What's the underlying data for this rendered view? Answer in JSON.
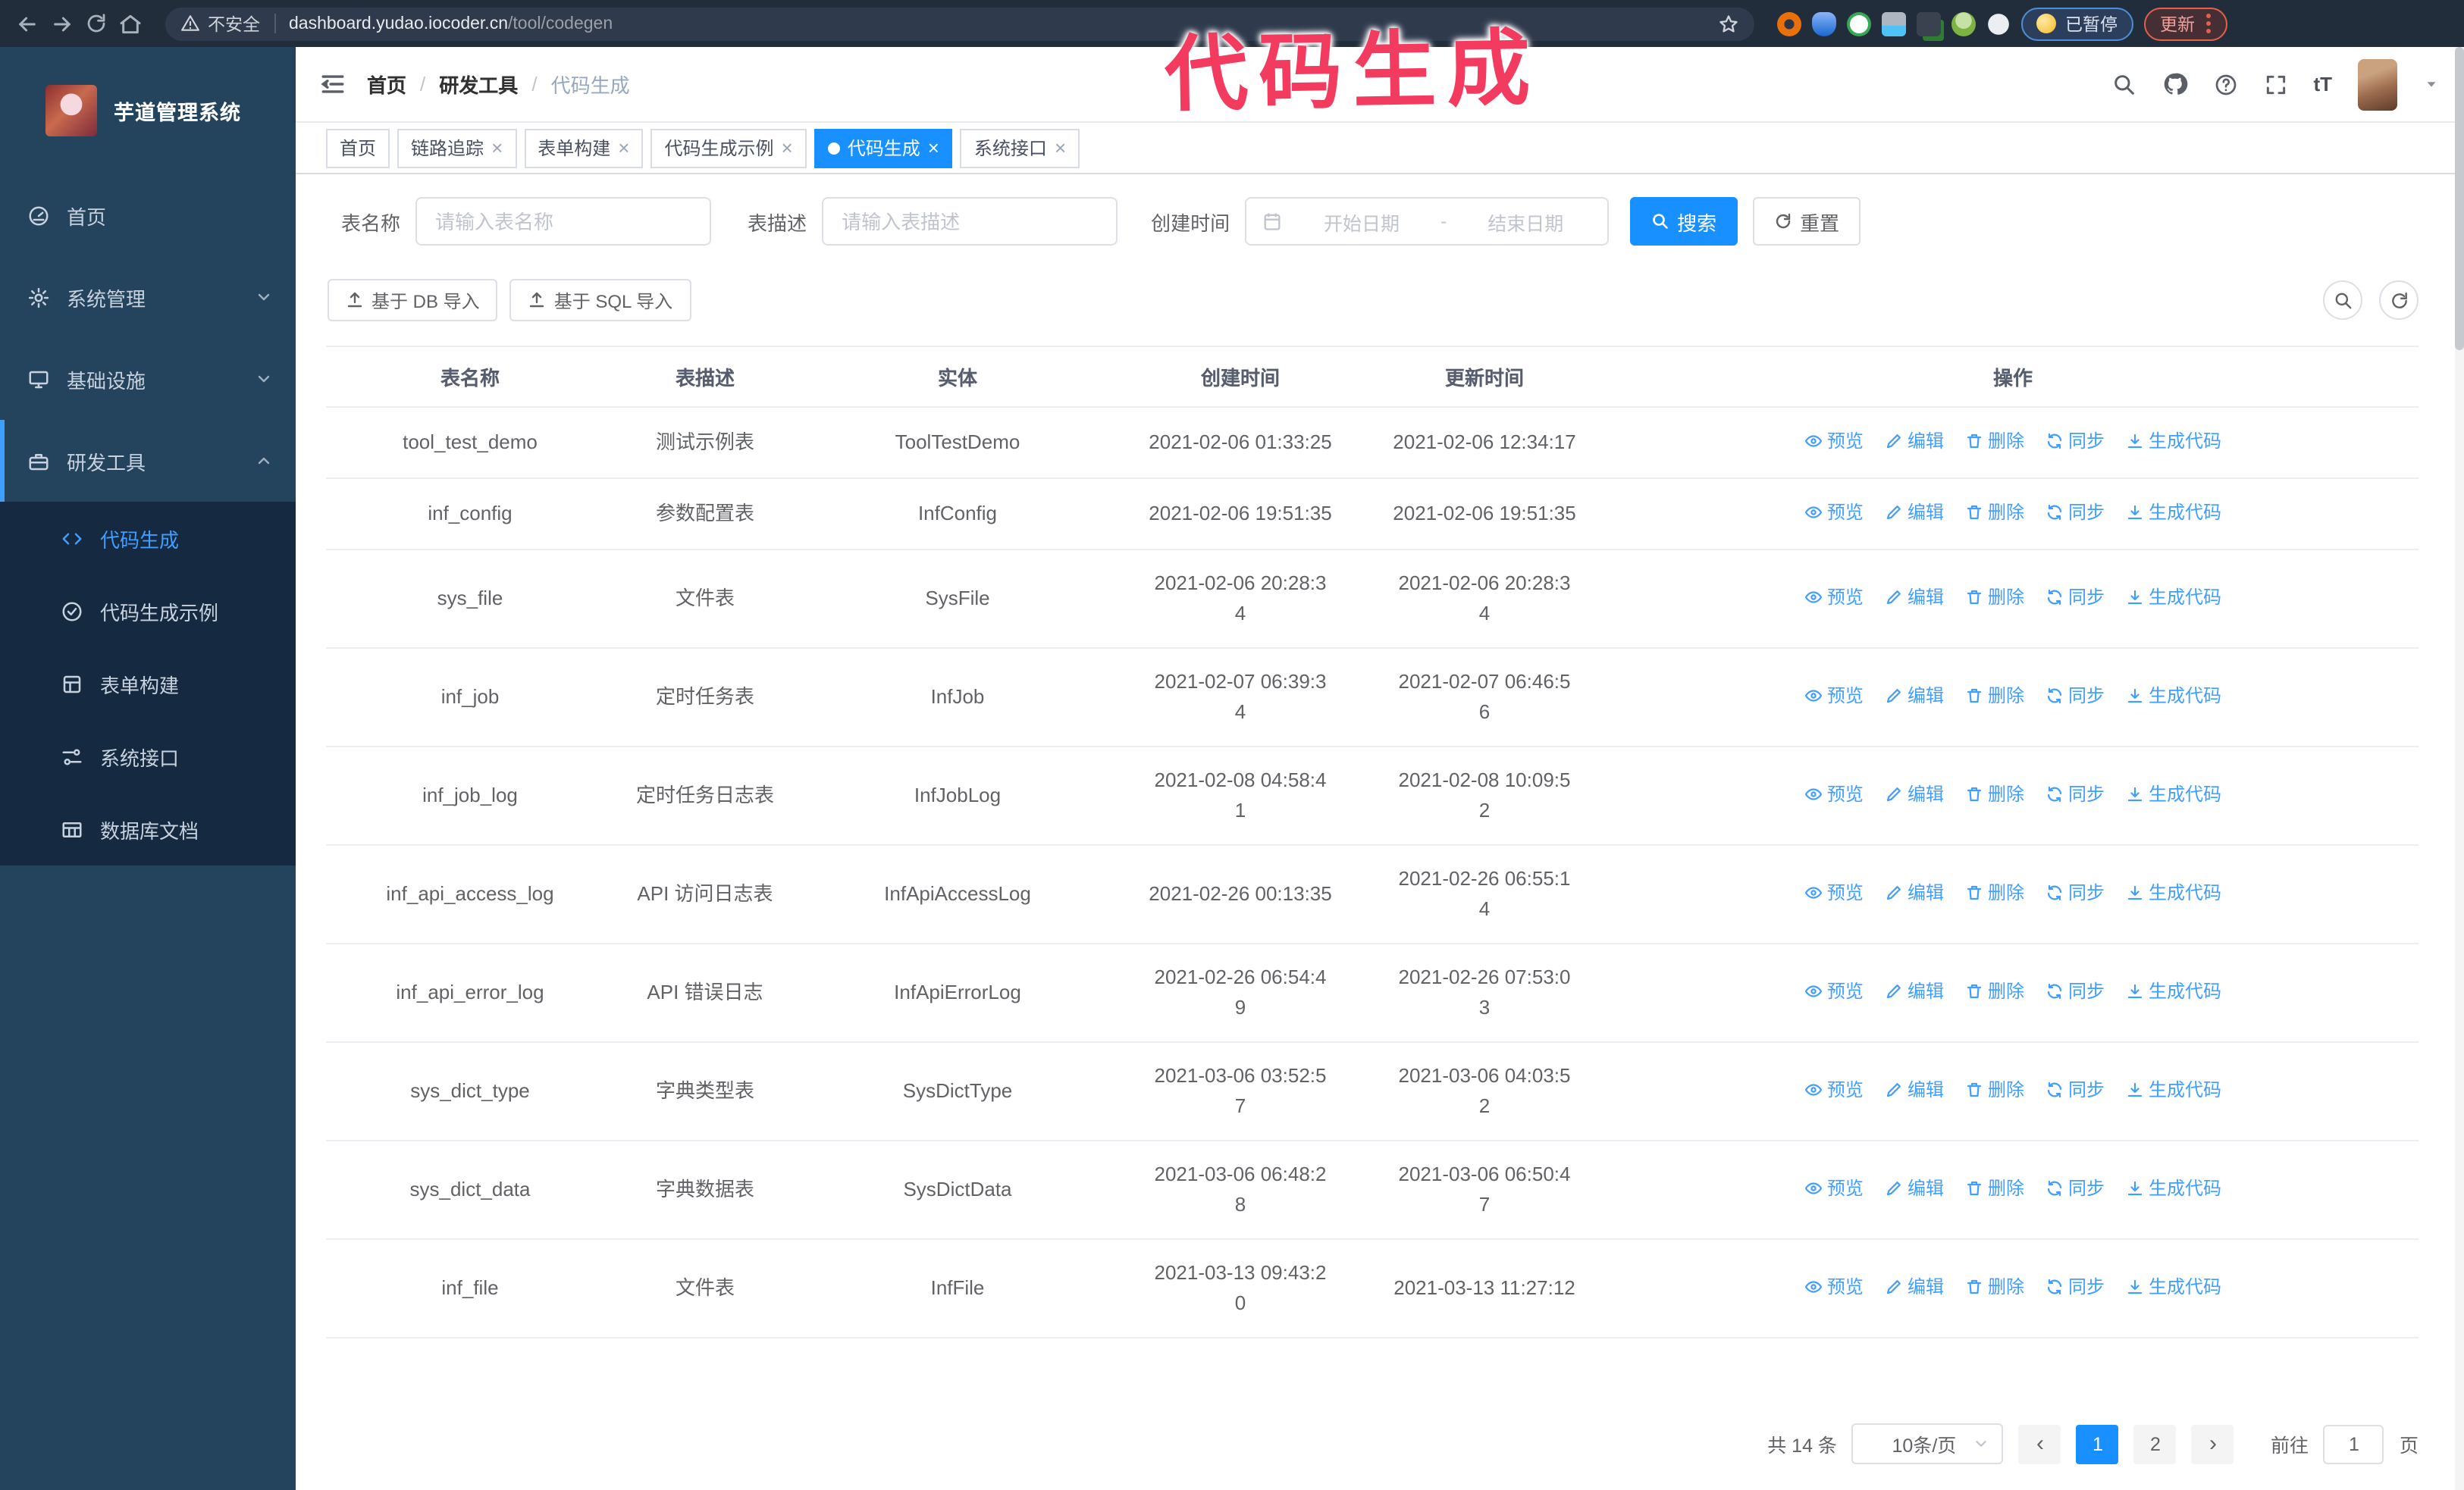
{
  "browser": {
    "security_label": "不安全",
    "url_domain": "dashboard.yudao.iocoder.cn",
    "url_path": "/tool/codegen",
    "paused_badge": "已暂停",
    "update_label": "更新"
  },
  "annotation": {
    "text": "代码生成"
  },
  "sidebar": {
    "title": "芋道管理系统",
    "items": [
      {
        "label": "首页",
        "icon": "dashboard-icon",
        "expanded": null,
        "active": false
      },
      {
        "label": "系统管理",
        "icon": "gear-icon",
        "expanded": false,
        "active": false
      },
      {
        "label": "基础设施",
        "icon": "monitor-icon",
        "expanded": false,
        "active": false
      },
      {
        "label": "研发工具",
        "icon": "toolbox-icon",
        "expanded": true,
        "active": true
      }
    ],
    "sub_items": [
      {
        "label": "代码生成",
        "icon": "code-icon",
        "active": true
      },
      {
        "label": "代码生成示例",
        "icon": "check-badge-icon",
        "active": false
      },
      {
        "label": "表单构建",
        "icon": "form-icon",
        "active": false
      },
      {
        "label": "系统接口",
        "icon": "sliders-icon",
        "active": false
      },
      {
        "label": "数据库文档",
        "icon": "database-doc-icon",
        "active": false
      }
    ]
  },
  "navbar": {
    "breadcrumb": [
      "首页",
      "研发工具",
      "代码生成"
    ]
  },
  "tags": [
    {
      "label": "首页",
      "closable": false,
      "active": false
    },
    {
      "label": "链路追踪",
      "closable": true,
      "active": false
    },
    {
      "label": "表单构建",
      "closable": true,
      "active": false
    },
    {
      "label": "代码生成示例",
      "closable": true,
      "active": false
    },
    {
      "label": "代码生成",
      "closable": true,
      "active": true
    },
    {
      "label": "系统接口",
      "closable": true,
      "active": false
    }
  ],
  "search": {
    "name_label": "表名称",
    "name_placeholder": "请输入表名称",
    "desc_label": "表描述",
    "desc_placeholder": "请输入表描述",
    "time_label": "创建时间",
    "start_placeholder": "开始日期",
    "range_separator": "-",
    "end_placeholder": "结束日期",
    "search_button": "搜索",
    "reset_button": "重置"
  },
  "toolbar": {
    "db_import": "基于 DB 导入",
    "sql_import": "基于 SQL 导入"
  },
  "table": {
    "headers": [
      "表名称",
      "表描述",
      "实体",
      "创建时间",
      "更新时间",
      "操作"
    ],
    "row_actions": [
      "预览",
      "编辑",
      "删除",
      "同步",
      "生成代码"
    ],
    "rows": [
      {
        "name": "tool_test_demo",
        "desc": "测试示例表",
        "entity": "ToolTestDemo",
        "created": "2021-02-06 01:33:25",
        "updated": "2021-02-06 12:34:17"
      },
      {
        "name": "inf_config",
        "desc": "参数配置表",
        "entity": "InfConfig",
        "created": "2021-02-06 19:51:35",
        "updated": "2021-02-06 19:51:35"
      },
      {
        "name": "sys_file",
        "desc": "文件表",
        "entity": "SysFile",
        "created": "2021-02-06 20:28:3\n4",
        "updated": "2021-02-06 20:28:3\n4"
      },
      {
        "name": "inf_job",
        "desc": "定时任务表",
        "entity": "InfJob",
        "created": "2021-02-07 06:39:3\n4",
        "updated": "2021-02-07 06:46:5\n6"
      },
      {
        "name": "inf_job_log",
        "desc": "定时任务日志表",
        "entity": "InfJobLog",
        "created": "2021-02-08 04:58:4\n1",
        "updated": "2021-02-08 10:09:5\n2"
      },
      {
        "name": "inf_api_access_log",
        "desc": "API 访问日志表",
        "entity": "InfApiAccessLog",
        "created": "2021-02-26 00:13:35",
        "updated": "2021-02-26 06:55:1\n4"
      },
      {
        "name": "inf_api_error_log",
        "desc": "API 错误日志",
        "entity": "InfApiErrorLog",
        "created": "2021-02-26 06:54:4\n9",
        "updated": "2021-02-26 07:53:0\n3"
      },
      {
        "name": "sys_dict_type",
        "desc": "字典类型表",
        "entity": "SysDictType",
        "created": "2021-03-06 03:52:5\n7",
        "updated": "2021-03-06 04:03:5\n2"
      },
      {
        "name": "sys_dict_data",
        "desc": "字典数据表",
        "entity": "SysDictData",
        "created": "2021-03-06 06:48:2\n8",
        "updated": "2021-03-06 06:50:4\n7"
      },
      {
        "name": "inf_file",
        "desc": "文件表",
        "entity": "InfFile",
        "created": "2021-03-13 09:43:2\n0",
        "updated": "2021-03-13 11:27:12"
      }
    ]
  },
  "pagination": {
    "total": "共 14 条",
    "page_size": "10条/页",
    "pages": [
      "1",
      "2"
    ],
    "current_page": "1",
    "goto_label": "前往",
    "goto_value": "1",
    "goto_suffix": "页"
  },
  "colors": {
    "accent": "#1890ff",
    "link": "#409eff",
    "sidebar_bg": "#24435c",
    "submenu_bg": "#152a40",
    "annotation": "#f23b5f"
  }
}
